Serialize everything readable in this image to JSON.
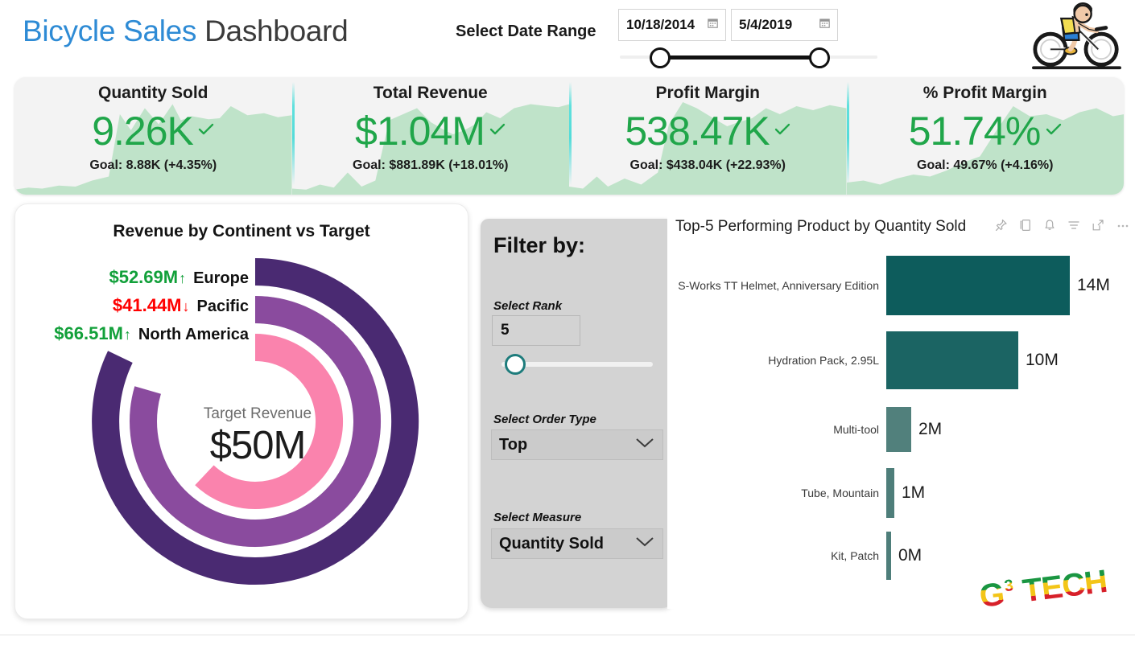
{
  "header": {
    "title_accent": "Bicycle Sales",
    "title_rest": " Dashboard",
    "date_range_label": "Select Date Range",
    "date_from": "10/18/2014",
    "date_to": "5/4/2019",
    "calendar_icon": "calendar-icon",
    "cyclist_icon": "cyclist-icon"
  },
  "kpis": [
    {
      "name": "Quantity Sold",
      "value": "9.26K",
      "goal": "Goal: 8.88K (+4.35%)",
      "status_icon": "check-icon"
    },
    {
      "name": "Total Revenue",
      "value": "$1.04M",
      "goal": "Goal: $881.89K (+18.01%)",
      "status_icon": "check-icon"
    },
    {
      "name": "Profit Margin",
      "value": "538.47K",
      "goal": "Goal: $438.04K (+22.93%)",
      "status_icon": "check-icon"
    },
    {
      "name": "% Profit Margin",
      "value": "51.74%",
      "goal": "Goal: 49.67% (+4.16%)",
      "status_icon": "check-icon"
    }
  ],
  "radial": {
    "title": "Revenue by Continent vs Target",
    "center_caption": "Target Revenue",
    "center_value": "$50M",
    "legend": [
      {
        "value": "$52.69M",
        "arrow": "↑",
        "direction": "up",
        "name": "Europe"
      },
      {
        "value": "$41.44M",
        "arrow": "↓",
        "direction": "down",
        "name": "Pacific"
      },
      {
        "value": "$66.51M",
        "arrow": "↑",
        "direction": "up",
        "name": "North America"
      }
    ]
  },
  "filter": {
    "title": "Filter by:",
    "rank_label": "Select Rank",
    "rank_value": "5",
    "order_label": "Select Order Type",
    "order_value": "Top",
    "measure_label": "Select Measure",
    "measure_value": "Quantity Sold",
    "chevron_icon": "chevron-down-icon"
  },
  "bar_visual": {
    "title": "Top-5 Performing Product by Quantity Sold",
    "header_icons": [
      "pin-icon",
      "copy-icon",
      "bell-icon",
      "filter-icon",
      "focus-mode-icon",
      "more-options-icon"
    ]
  },
  "logo": {
    "text": "G3 TECH"
  },
  "chart_data": [
    {
      "type": "bar",
      "orientation": "horizontal",
      "title": "Top-5 Performing Product by Quantity Sold",
      "xlabel": "",
      "ylabel": "",
      "categories": [
        "S-Works TT Helmet, Anniversary Edition",
        "Hydration Pack, 2.95L",
        "Multi-tool",
        "Tube, Mountain",
        "Kit, Patch"
      ],
      "values": [
        14,
        10,
        2,
        1,
        0.15
      ],
      "data_labels": [
        "14M",
        "10M",
        "2M",
        "1M",
        "0M"
      ],
      "unit": "M",
      "bar_colors": [
        "#0d5c5c",
        "#1b6463",
        "#51807c",
        "#4e7e7a",
        "#4e7e7a"
      ],
      "xlim": [
        0,
        16
      ],
      "grid": false,
      "legend": "none"
    },
    {
      "type": "pie",
      "subtype": "radial-bar-gauge",
      "title": "Revenue by Continent vs Target",
      "center_caption": "Target Revenue",
      "center_value": "$50M",
      "target": 50,
      "unit": "M",
      "categories": [
        "Europe",
        "Pacific",
        "North America"
      ],
      "values": [
        52.69,
        41.44,
        66.51
      ],
      "value_labels": [
        "$52.69M",
        "$41.44M",
        "$66.51M"
      ],
      "directions": [
        "up",
        "down",
        "up"
      ],
      "ring_colors": [
        "#4A2A72",
        "#8A4B9E",
        "#FA83AD"
      ],
      "remainder_color": "#C9C9C9",
      "legend": "left"
    },
    {
      "type": "area",
      "subtype": "kpi-sparklines",
      "title": "KPI trend sparklines",
      "series": [
        {
          "name": "Quantity Sold",
          "values": [
            6,
            8,
            7,
            10,
            9,
            14,
            20,
            62,
            70,
            58,
            66,
            64,
            72,
            60,
            76,
            66,
            62
          ]
        },
        {
          "name": "Total Revenue",
          "values": [
            8,
            7,
            12,
            9,
            22,
            10,
            16,
            70,
            66,
            78,
            60,
            52,
            50,
            56,
            72,
            58,
            78
          ]
        },
        {
          "name": "Profit Margin",
          "values": [
            10,
            9,
            20,
            12,
            18,
            11,
            24,
            64,
            84,
            74,
            62,
            58,
            64,
            68,
            78,
            64,
            80
          ]
        },
        {
          "name": "% Profit Margin",
          "values": [
            14,
            16,
            12,
            18,
            22,
            20,
            26,
            32,
            40,
            64,
            78,
            70,
            72,
            66,
            74,
            80,
            72
          ]
        }
      ],
      "fill_color": "#BFE3C9",
      "grid": false,
      "legend": "none"
    }
  ]
}
